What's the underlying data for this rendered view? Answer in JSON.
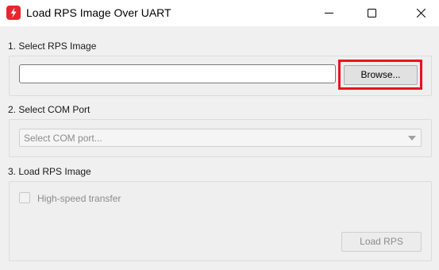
{
  "window": {
    "title": "Load RPS Image Over UART",
    "app_icon": "lightning-bolt-icon",
    "controls": {
      "minimize_icon": "minimize-icon",
      "maximize_icon": "maximize-icon",
      "close_icon": "close-icon"
    }
  },
  "sections": {
    "select_image": {
      "label": "1. Select RPS Image",
      "path_value": "",
      "browse_label": "Browse...",
      "highlight_color": "#e8141f"
    },
    "select_com": {
      "label": "2. Select COM Port",
      "placeholder": "Select COM port...",
      "dropdown_icon": "chevron-down-icon"
    },
    "load_image": {
      "label": "3. Load RPS Image",
      "high_speed_label": "High-speed transfer",
      "high_speed_checked": false,
      "load_label": "Load RPS"
    }
  },
  "colors": {
    "accent": "#e8262f",
    "highlight": "#e8141f",
    "disabled_text": "#8c8c8c"
  }
}
